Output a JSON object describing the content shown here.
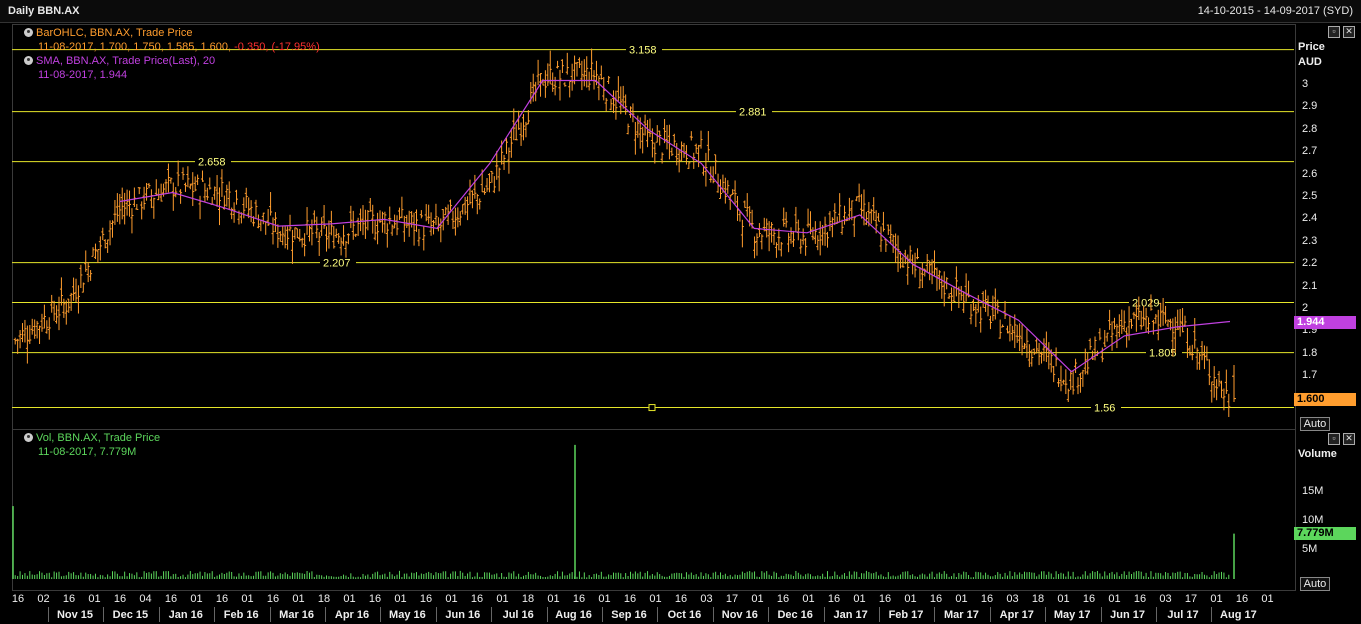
{
  "header": {
    "title": "Daily BBN.AX",
    "range": "14-10-2015 - 14-09-2017 (SYD)"
  },
  "price_legend": {
    "ohlc_name": "BarOHLC, BBN.AX, Trade Price",
    "ohlc_values": "11-08-2017, 1.700, 1.750, 1.585, 1.600,",
    "ohlc_change": "-0.350, (-17.95%)",
    "sma_name": "SMA, BBN.AX, Trade Price(Last), 20",
    "sma_value": "11-08-2017, 1.944"
  },
  "volume_legend": {
    "name": "Vol, BBN.AX, Trade Price",
    "value": "11-08-2017, 7.779M"
  },
  "price_axis": {
    "title1": "Price",
    "title2": "AUD",
    "last_price": "1.600",
    "sma_last": "1.944",
    "auto": "Auto"
  },
  "volume_axis": {
    "title": "Volume",
    "last_volume": "7.779M",
    "auto": "Auto"
  },
  "colors": {
    "bars": "#ff9d2e",
    "sma": "#c040e0",
    "levels": "#e6e62a",
    "volume": "#5cd65c",
    "change": "#ff3030"
  },
  "chart_data": [
    {
      "type": "bar",
      "subtype": "ohlc",
      "title": "Daily BBN.AX",
      "ylabel": "Price AUD",
      "ylim": [
        1.55,
        3.22
      ],
      "yticks": [
        "3",
        "2.9",
        "2.8",
        "2.7",
        "2.6",
        "2.5",
        "2.4",
        "2.3",
        "2.2",
        "2.1",
        "2",
        "1.9",
        "1.8",
        "1.7"
      ],
      "grid": false,
      "x_day_ticks": [
        "16",
        "02",
        "16",
        "01",
        "16",
        "04",
        "16",
        "01",
        "16",
        "01",
        "16",
        "01",
        "18",
        "01",
        "16",
        "01",
        "16",
        "01",
        "16",
        "01",
        "18",
        "01",
        "16",
        "01",
        "16",
        "01",
        "16",
        "03",
        "17",
        "01",
        "16",
        "01",
        "16",
        "01",
        "16",
        "01",
        "16",
        "01",
        "16",
        "03",
        "18",
        "01",
        "16",
        "01",
        "16",
        "03",
        "17",
        "01",
        "16",
        "01"
      ],
      "x_month_labels": [
        "Nov 15",
        "Dec 15",
        "Jan 16",
        "Feb 16",
        "Mar 16",
        "Apr 16",
        "May 16",
        "Jun 16",
        "Jul 16",
        "Aug 16",
        "Sep 16",
        "Oct 16",
        "Nov 16",
        "Dec 16",
        "Jan 17",
        "Feb 17",
        "Mar 17",
        "Apr 17",
        "May 17",
        "Jun 17",
        "Jul 17",
        "Aug 17"
      ],
      "series": [
        {
          "name": "BarOHLC, BBN.AX, Trade Price",
          "month_closes": [
            1.86,
            2.03,
            2.45,
            2.55,
            2.52,
            2.35,
            2.33,
            2.4,
            2.36,
            2.55,
            3.03,
            3.05,
            2.75,
            2.7,
            2.35,
            2.32,
            2.45,
            2.2,
            2.05,
            1.9,
            1.68,
            1.94,
            1.95,
            1.6
          ]
        },
        {
          "name": "SMA, BBN.AX, Trade Price(Last), 20",
          "month_values": [
            1.95,
            2.3,
            2.48,
            2.52,
            2.45,
            2.37,
            2.38,
            2.4,
            2.36,
            2.65,
            3.02,
            3.02,
            2.8,
            2.65,
            2.36,
            2.34,
            2.42,
            2.2,
            2.07,
            1.95,
            1.72,
            1.88,
            1.92,
            1.944
          ]
        }
      ],
      "levels": [
        {
          "label": "3.158",
          "value": 3.158
        },
        {
          "label": "2.881",
          "value": 2.881
        },
        {
          "label": "2.658",
          "value": 2.658
        },
        {
          "label": "2.207",
          "value": 2.207
        },
        {
          "label": "2.029",
          "value": 2.029
        },
        {
          "label": "1.805",
          "value": 1.805
        },
        {
          "label": "1.56",
          "value": 1.56
        }
      ],
      "last": {
        "date": "11-08-2017",
        "open": 1.7,
        "high": 1.75,
        "low": 1.585,
        "close": 1.6,
        "change": -0.35,
        "change_pct": -17.95
      }
    },
    {
      "type": "bar",
      "title": "Volume",
      "ylabel": "Volume",
      "yticks": [
        "15M",
        "10M",
        "5M"
      ],
      "ylim": [
        0,
        24000000
      ],
      "series": [
        {
          "name": "Vol, BBN.AX, Trade Price"
        }
      ],
      "spikes": [
        {
          "at": "Oct 15",
          "value": 12500000
        },
        {
          "at": "Aug 16",
          "value": 23000000
        },
        {
          "at": "11-08-2017",
          "value": 7779000
        }
      ],
      "typical_daily": 700000
    }
  ]
}
